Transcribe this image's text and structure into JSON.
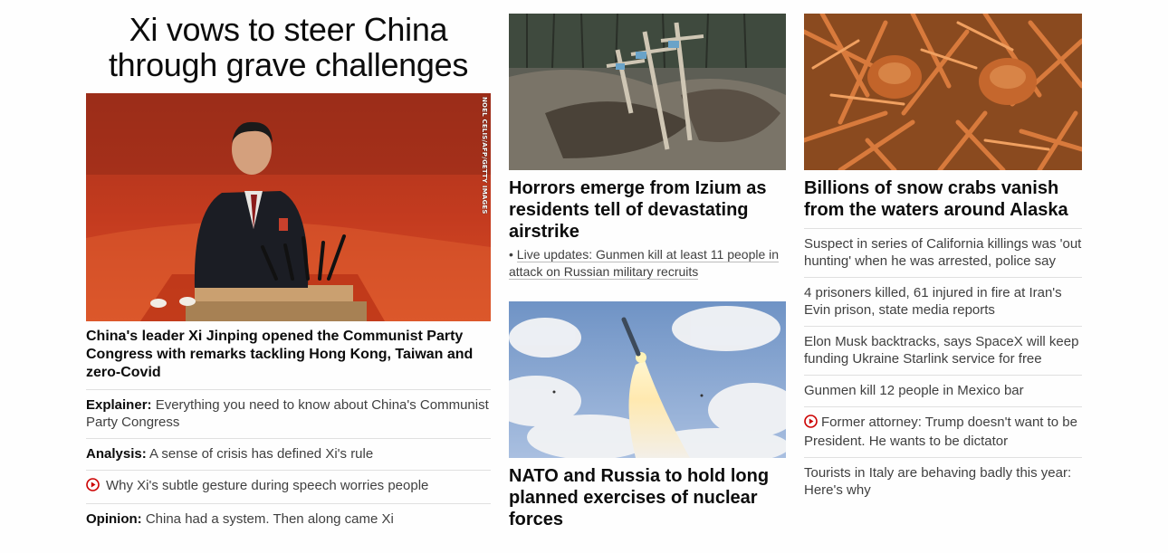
{
  "col1": {
    "headline": "Xi vows to steer China through grave challenges",
    "image_credit": "NOEL CELIS/AFP/GETTY IMAGES",
    "caption": "China's leader Xi Jinping opened the Communist Party Congress with remarks tackling Hong Kong, Taiwan and zero-Covid",
    "items": [
      {
        "prefix": "Explainer:",
        "text": "Everything you need to know about China's Communist Party Congress"
      },
      {
        "prefix": "Analysis:",
        "text": "A sense of crisis has defined Xi's rule"
      },
      {
        "prefix": "",
        "text": "Why Xi's subtle gesture during speech worries people",
        "video": true
      },
      {
        "prefix": "Opinion:",
        "text": "China had a system. Then along came Xi"
      }
    ]
  },
  "col2": {
    "story1": {
      "headline": "Horrors emerge from Izium as residents tell of devastating airstrike",
      "live_update": "Live updates: Gunmen kill at least 11 people in attack on Russian military recruits"
    },
    "story2": {
      "headline": "NATO and Russia to hold long planned exercises of nuclear forces"
    }
  },
  "col3": {
    "headline": "Billions of snow crabs vanish from the waters around Alaska",
    "items": [
      {
        "text": "Suspect in series of California killings was 'out hunting' when he was arrested, police say"
      },
      {
        "text": "4 prisoners killed, 61 injured in fire at Iran's Evin prison, state media reports"
      },
      {
        "text": "Elon Musk backtracks, says SpaceX will keep funding Ukraine Starlink service for free"
      },
      {
        "text": "Gunmen kill 12 people in Mexico bar"
      },
      {
        "text": "Former attorney: Trump doesn't want to be President. He wants to be dictator",
        "video": true
      },
      {
        "text": "Tourists in Italy are behaving badly this year: Here's why"
      }
    ]
  },
  "colors": {
    "headline": "#0c0c0c",
    "body": "#404040",
    "divider": "#e0e0e0",
    "video_icon": "#cc0000"
  }
}
